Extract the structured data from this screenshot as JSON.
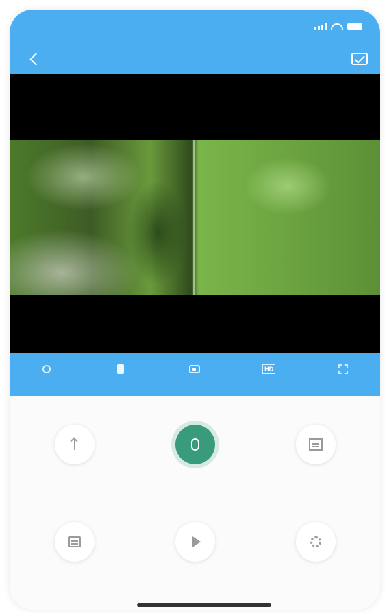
{
  "status_bar": {
    "time": "",
    "icons": [
      "signal-icon",
      "wifi-icon",
      "battery-icon"
    ]
  },
  "nav": {
    "title": "",
    "back_icon": "chevron-left-icon",
    "message_icon": "message-icon"
  },
  "video": {
    "stat_text": ""
  },
  "controls": [
    {
      "id": "speaker",
      "label": "",
      "icon": "speaker-icon"
    },
    {
      "id": "record",
      "label": "",
      "icon": "record-icon"
    },
    {
      "id": "snapshot",
      "label": "",
      "icon": "snapshot-icon"
    },
    {
      "id": "quality",
      "label": "",
      "icon": "hd-icon"
    },
    {
      "id": "fullscreen",
      "label": "",
      "icon": "fullscreen-icon"
    }
  ],
  "features": [
    {
      "id": "remote",
      "label": "",
      "icon": "arrow-up-icon"
    },
    {
      "id": "hold-to-talk",
      "label": "",
      "icon": "microphone-icon",
      "active": true
    },
    {
      "id": "playback",
      "label": "",
      "icon": "document-icon"
    },
    {
      "id": "schedule",
      "label": "",
      "icon": "calendar-icon"
    },
    {
      "id": "video",
      "label": "",
      "icon": "play-icon"
    },
    {
      "id": "settings",
      "label": "",
      "icon": "gear-icon"
    }
  ],
  "colors": {
    "header": "#4aaef0",
    "active_feature": "#3a9b7c",
    "video_bg": "#000000"
  }
}
